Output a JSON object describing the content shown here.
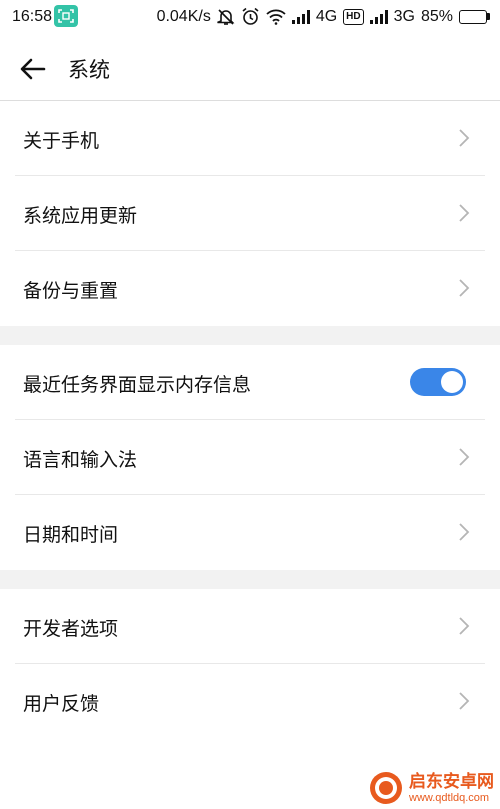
{
  "status_bar": {
    "time": "16:58",
    "speed": "0.04K/s",
    "sim1_type": "4G",
    "hd_badge": "HD",
    "sim2_type": "3G",
    "battery_text": "85%",
    "battery_level": 0.85,
    "icons": [
      "screenshot-app-icon",
      "mute-bell-icon",
      "alarm-icon",
      "wifi-icon",
      "signal-icon",
      "battery-icon"
    ]
  },
  "header": {
    "title": "系统",
    "back_icon": "arrow-left-icon"
  },
  "sections": [
    {
      "items": [
        {
          "label": "关于手机",
          "control": "chevron"
        },
        {
          "label": "系统应用更新",
          "control": "chevron"
        },
        {
          "label": "备份与重置",
          "control": "chevron"
        }
      ]
    },
    {
      "items": [
        {
          "label": "最近任务界面显示内存信息",
          "control": "toggle",
          "toggle_on": true
        },
        {
          "label": "语言和输入法",
          "control": "chevron"
        },
        {
          "label": "日期和时间",
          "control": "chevron"
        }
      ]
    },
    {
      "items": [
        {
          "label": "开发者选项",
          "control": "chevron"
        },
        {
          "label": "用户反馈",
          "control": "chevron"
        }
      ]
    }
  ],
  "watermark": {
    "name": "启东安卓网",
    "url": "www.qdtldq.com"
  },
  "colors": {
    "accent": "#3a86e8",
    "battery": "#1fb33a",
    "app_icon": "#33c3a7",
    "watermark": "#e85a1e"
  }
}
